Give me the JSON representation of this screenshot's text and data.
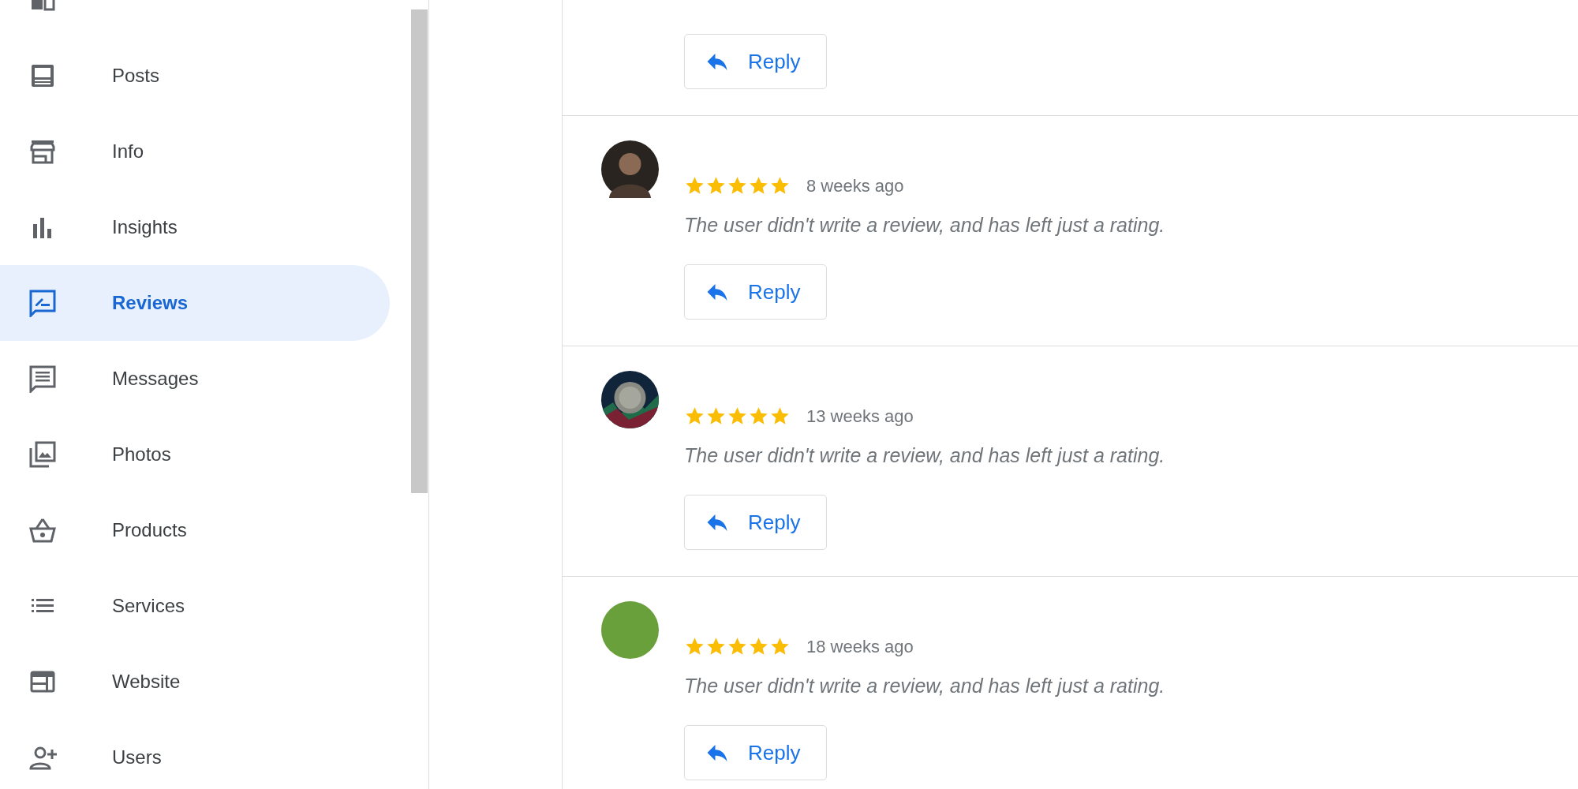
{
  "sidebar": {
    "items": [
      {
        "kind": "home",
        "selected": false
      },
      {
        "label": "Posts",
        "kind": "posts",
        "selected": false
      },
      {
        "label": "Info",
        "kind": "info",
        "selected": false
      },
      {
        "label": "Insights",
        "kind": "insights",
        "selected": false
      },
      {
        "label": "Reviews",
        "kind": "reviews",
        "selected": true
      },
      {
        "label": "Messages",
        "kind": "messages",
        "selected": false
      },
      {
        "label": "Photos",
        "kind": "photos",
        "selected": false
      },
      {
        "label": "Products",
        "kind": "products",
        "selected": false
      },
      {
        "label": "Services",
        "kind": "services",
        "selected": false
      },
      {
        "label": "Website",
        "kind": "website",
        "selected": false
      },
      {
        "label": "Users",
        "kind": "users",
        "selected": false
      }
    ]
  },
  "reviews": [
    {
      "reply": "Reply"
    },
    {
      "stars": 5,
      "time": "8 weeks ago",
      "text": "The user didn't write a review, and has left just a rating.",
      "reply": "Reply"
    },
    {
      "kind": "picture",
      "stars": 5,
      "time": "13 weeks ago",
      "text": "The user didn't write a review, and has left just a rating.",
      "reply": "Reply"
    },
    {
      "kind": "color",
      "color": "#6aa03c",
      "stars": 5,
      "time": "18 weeks ago",
      "text": "The user didn't write a review, and has left just a rating.",
      "reply": "Reply"
    }
  ]
}
